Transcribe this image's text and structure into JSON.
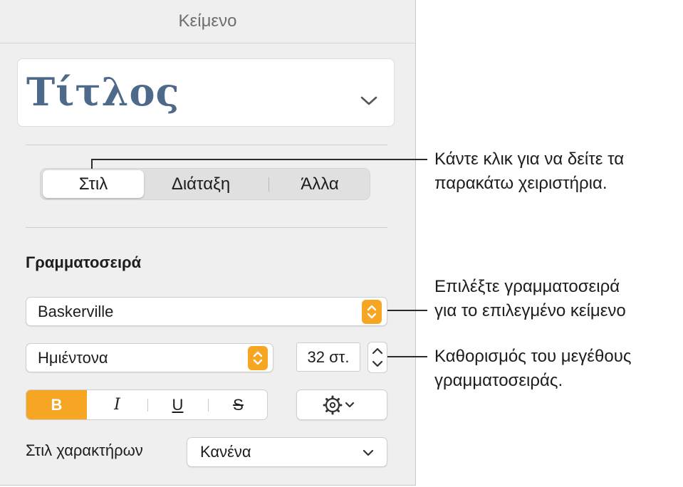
{
  "panel": {
    "header_title": "Κείμενο",
    "paragraph_style": "Τίτλος",
    "tabs": [
      {
        "label": "Στιλ",
        "active": true
      },
      {
        "label": "Διάταξη",
        "active": false
      },
      {
        "label": "Άλλα",
        "active": false
      }
    ],
    "font_section_label": "Γραμματοσειρά",
    "font_family": "Baskerville",
    "font_typeface": "Ημιέντονα",
    "font_size": "32 στ.",
    "format_buttons": {
      "bold": "B",
      "italic": "I",
      "underline": "U",
      "strikethrough": "S"
    },
    "char_style_label": "Στιλ χαρακτήρων",
    "char_style_value": "Κανένα"
  },
  "callouts": {
    "tabs": [
      "Κάντε κλικ για να δείτε τα",
      "παρακάτω χειριστήρια."
    ],
    "font": [
      "Επιλέξτε γραμματοσειρά",
      "για το επιλεγμένο κείμενο"
    ],
    "size": [
      "Καθορισμός του μεγέθους",
      "γραμματοσειράς."
    ]
  },
  "colors": {
    "accent": "#f6a623",
    "style_title": "#4e6a8a"
  },
  "icons": {
    "card": "chevron-down-icon",
    "font_popup": "up-down-arrows-icon",
    "size_stepper": "stepper-icon",
    "gear": "gear-icon"
  }
}
